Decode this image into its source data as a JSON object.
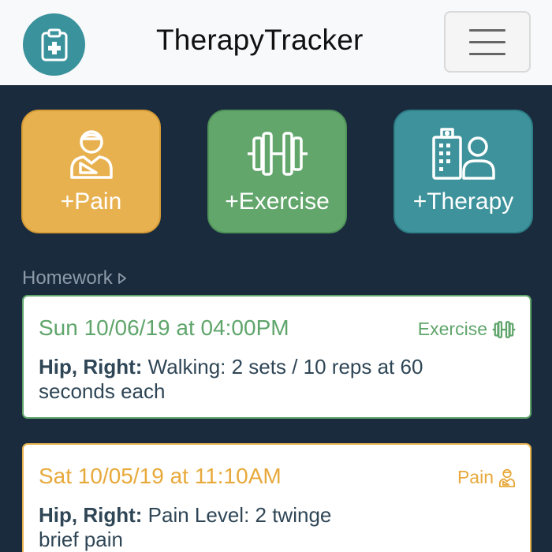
{
  "app": {
    "title": "TherapyTracker"
  },
  "quick_actions": [
    {
      "label": "+Pain",
      "icon": "injured-person-icon",
      "color": "#e8b14f"
    },
    {
      "label": "+Exercise",
      "icon": "dumbbell-icon",
      "color": "#62a66c"
    },
    {
      "label": "+Therapy",
      "icon": "hospital-user-icon",
      "color": "#3d929b"
    }
  ],
  "homework": {
    "title": "Homework",
    "entries": [
      {
        "datetime": "Sun 10/06/19 at 04:00PM",
        "type": "Exercise",
        "type_icon": "dumbbell-icon",
        "location": "Hip, Right:",
        "detail_line1": "Walking: 2 sets / 10 reps at 60",
        "detail_line2": "seconds each",
        "color": "#5fa56b"
      },
      {
        "datetime": "Sat 10/05/19 at 11:10AM",
        "type": "Pain",
        "type_icon": "injured-person-icon",
        "location": "Hip, Right:",
        "detail_line1": "Pain Level: 2 twinge",
        "detail_line2": "brief pain",
        "color": "#e8a93b"
      }
    ]
  }
}
